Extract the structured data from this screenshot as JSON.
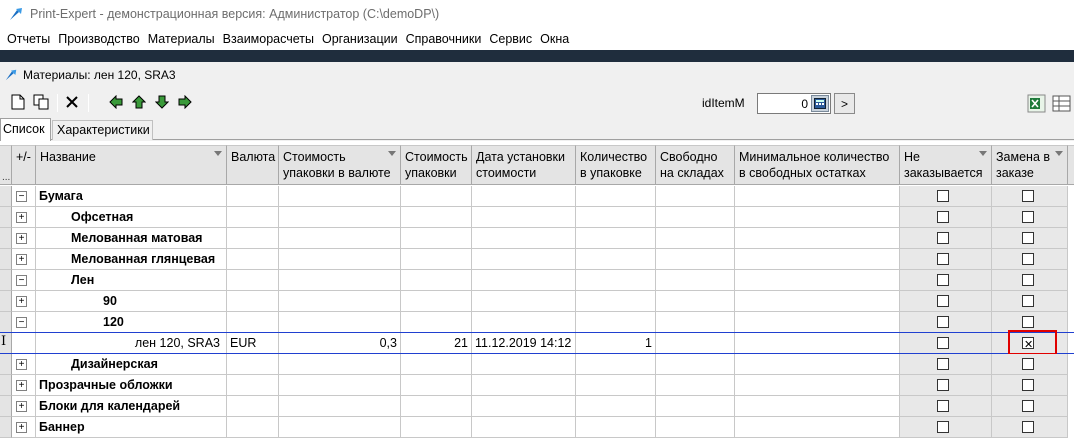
{
  "window": {
    "title": "Print-Expert - демонстрационная версия: Администратор (C:\\demoDP\\)"
  },
  "menu": [
    "Отчеты",
    "Производство",
    "Материалы",
    "Взаиморасчеты",
    "Организации",
    "Справочники",
    "Сервис",
    "Окна"
  ],
  "document": {
    "title": "Материалы: лен 120, SRA3"
  },
  "toolbar": {
    "id_label": "idItemM",
    "id_value": "0",
    "go_label": ">"
  },
  "tabs": [
    {
      "label": "Список",
      "active": true
    },
    {
      "label": "Характеристики",
      "active": false
    }
  ],
  "grid": {
    "columns": [
      {
        "key": "pm",
        "label": "+/-"
      },
      {
        "key": "name",
        "label": "Название"
      },
      {
        "key": "currency",
        "label": "Валюта"
      },
      {
        "key": "pack_cost_cur",
        "label": "Стоимость упаковки в валюте"
      },
      {
        "key": "pack_cost",
        "label": "Стоимость упаковки"
      },
      {
        "key": "cost_date",
        "label": "Дата установки стоимости"
      },
      {
        "key": "qty_pack",
        "label": "Количество в упаковке"
      },
      {
        "key": "free",
        "label": "Свободно на складах"
      },
      {
        "key": "min_qty",
        "label": "Минимальное количество в свободных остатках"
      },
      {
        "key": "not_ordered",
        "label": "Не заказывается"
      },
      {
        "key": "replace",
        "label": "Замена в заказе"
      }
    ],
    "rows": [
      {
        "expander": "−",
        "level": 0,
        "name": "Бумага",
        "bold": true,
        "not_ordered": false,
        "replace": false
      },
      {
        "expander": "+",
        "level": 1,
        "name": "Офсетная",
        "bold": true,
        "not_ordered": false,
        "replace": false
      },
      {
        "expander": "+",
        "level": 1,
        "name": "Мелованная матовая",
        "bold": true,
        "not_ordered": false,
        "replace": false
      },
      {
        "expander": "+",
        "level": 1,
        "name": "Мелованная глянцевая",
        "bold": true,
        "not_ordered": false,
        "replace": false
      },
      {
        "expander": "−",
        "level": 1,
        "name": "Лен",
        "bold": true,
        "not_ordered": false,
        "replace": false
      },
      {
        "expander": "+",
        "level": 2,
        "name": "90",
        "bold": true,
        "not_ordered": false,
        "replace": false
      },
      {
        "expander": "−",
        "level": 2,
        "name": "120",
        "bold": true,
        "not_ordered": false,
        "replace": false
      },
      {
        "expander": "",
        "level": 3,
        "name": "лен 120, SRA3",
        "bold": false,
        "selected": true,
        "currency": "EUR",
        "pack_cost_cur": "0,3",
        "pack_cost": "21",
        "cost_date": "11.12.2019 14:12",
        "qty_pack": "1",
        "not_ordered": false,
        "replace": true
      },
      {
        "expander": "+",
        "level": 1,
        "name": "Дизайнерская",
        "bold": true,
        "not_ordered": false,
        "replace": false
      },
      {
        "expander": "+",
        "level": 0,
        "name": "Прозрачные обложки",
        "bold": true,
        "not_ordered": false,
        "replace": false
      },
      {
        "expander": "+",
        "level": 0,
        "name": "Блоки для календарей",
        "bold": true,
        "not_ordered": false,
        "replace": false
      },
      {
        "expander": "+",
        "level": 0,
        "name": "Баннер",
        "bold": true,
        "not_ordered": false,
        "replace": false
      }
    ]
  },
  "colors": {
    "selection_line": "#2040d0",
    "highlight_box": "#e00000",
    "title_bar_text": "#6d6d6d"
  }
}
